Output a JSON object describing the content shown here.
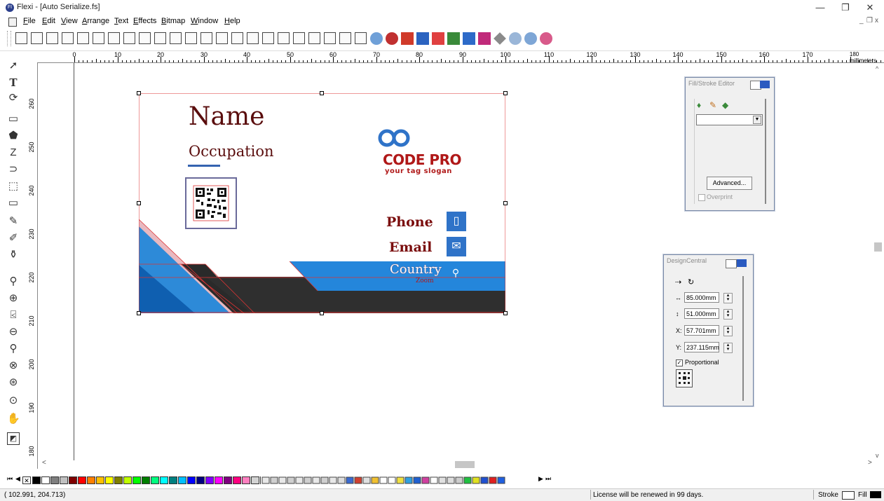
{
  "window": {
    "title": "Flexi - [Auto Serialize.fs]",
    "app_icon_text": "FI",
    "minimize_glyph": "—",
    "maximize_glyph": "❐",
    "close_glyph": "✕",
    "mdi_minimize": "_",
    "mdi_restore": "❐",
    "mdi_close": "x"
  },
  "menu": {
    "items": [
      "File",
      "Edit",
      "View",
      "Arrange",
      "Text",
      "Effects",
      "Bitmap",
      "Window",
      "Help"
    ]
  },
  "ruler": {
    "unit_label": "180 millimeters",
    "h_labels": [
      "0",
      "10",
      "20",
      "30",
      "40",
      "50",
      "60",
      "70",
      "80",
      "90",
      "100",
      "110",
      "120",
      "130",
      "140",
      "150",
      "160",
      "170"
    ],
    "v_labels": [
      "260",
      "250",
      "240",
      "230",
      "220",
      "210",
      "200",
      "190",
      "180"
    ]
  },
  "card": {
    "name": "Name",
    "occupation": "Occupation",
    "logo_text": "CODE PRO",
    "logo_slogan": "your tag slogan",
    "phone_label": "Phone",
    "email_label": "Email",
    "country_label": "Country",
    "zoom_label": "Zoom",
    "phone_icon": "▯",
    "email_icon": "✉",
    "location_icon": "⚲"
  },
  "fill_stroke_editor": {
    "title": "Fill/Stroke Editor",
    "advanced_button": "Advanced...",
    "overprint_label": "Overprint"
  },
  "design_central": {
    "title": "DesignCentral",
    "width_value": "85.000mm",
    "height_value": "51.000mm",
    "x_label": "X:",
    "x_value": "57.701mm",
    "y_label": "Y:",
    "y_value": "237.115mm",
    "proportional_label": "Proportional",
    "proportional_checked": true
  },
  "status": {
    "coords": "( 102.991,  204.713)",
    "license": "License will be renewed in 99 days.",
    "stroke_label": "Stroke",
    "fill_label": "Fill"
  },
  "palette_colors": [
    "#000000",
    "#ffffff",
    "#7f7f7f",
    "#c0c0c0",
    "#7f0000",
    "#ff0000",
    "#ff7f00",
    "#ffbf00",
    "#ffff00",
    "#7f7f00",
    "#bfff00",
    "#00ff00",
    "#007f00",
    "#00ff7f",
    "#00ffff",
    "#007f7f",
    "#00bfff",
    "#0000ff",
    "#00007f",
    "#7f00ff",
    "#ff00ff",
    "#7f007f",
    "#ff007f",
    "#ff7fbf",
    "#d3d3d3",
    "#a9a9a9"
  ]
}
